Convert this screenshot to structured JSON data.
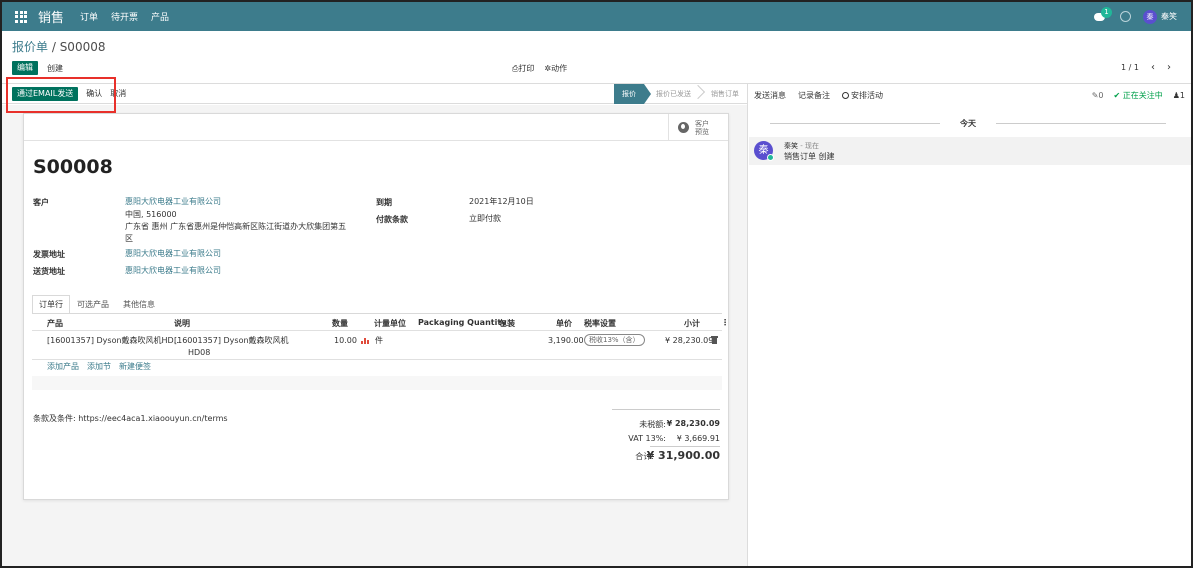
{
  "navbar": {
    "brand": "销售",
    "menu": [
      "订单",
      "待开票",
      "产品"
    ],
    "chat_badge": "1",
    "user_avatar": "秦",
    "user_name": "秦笑"
  },
  "breadcrumb": {
    "parent": "报价单",
    "separator": " / ",
    "current": "S00008"
  },
  "controls": {
    "edit": "编辑",
    "create": "创建",
    "print": "打印",
    "action": "动作",
    "pager": "1 / 1"
  },
  "statusbar": {
    "send_email": "通过EMAIL发送",
    "confirm": "确认",
    "cancel": "取消",
    "stages": [
      "报价",
      "报价已发送",
      "销售订单"
    ]
  },
  "preview": {
    "line1": "客户",
    "line2": "预览"
  },
  "order": {
    "name": "S00008",
    "customer_label": "客户",
    "customer_name": "惠阳大欣电器工业有限公司",
    "customer_addr1": "中国, 516000",
    "customer_addr2": "广东省 惠州 广东省惠州是仲恺高新区陈江街道办大欣集团第五",
    "customer_addr3": "区",
    "invoice_label": "发票地址",
    "invoice_value": "惠阳大欣电器工业有限公司",
    "delivery_label": "送货地址",
    "delivery_value": "惠阳大欣电器工业有限公司",
    "expiry_label": "到期",
    "expiry_value": "2021年12月10日",
    "terms_label": "付款条款",
    "terms_value": "立即付款"
  },
  "tabs": [
    "订单行",
    "可选产品",
    "其他信息"
  ],
  "lines": {
    "headers": {
      "product": "产品",
      "description": "说明",
      "qty": "数量",
      "uom": "计量单位",
      "packaging": "Packaging Quantity",
      "package": "包装",
      "price": "单价",
      "tax": "税率设置",
      "subtotal": "小计",
      "options": "⋮"
    },
    "rows": [
      {
        "product": "[16001357] Dyson戴森吹风机HD...",
        "desc1": "[16001357] Dyson戴森吹风机",
        "desc2": "HD08",
        "qty": "10.00",
        "uom": "件",
        "price": "3,190.00",
        "tax": "税收13%（含）",
        "subtotal": "¥ 28,230.09"
      }
    ],
    "add_product": "添加产品",
    "add_section": "添加节",
    "add_note": "新建便签"
  },
  "footer": {
    "terms": "条款及条件: https://eec4aca1.xiaoouyun.cn/terms",
    "untaxed_label": "未税额:",
    "untaxed_value": "¥ 28,230.09",
    "vat_label": "VAT 13%:",
    "vat_value": "¥ 3,669.91",
    "total_label": "合计:",
    "total_value": "¥ 31,900.00"
  },
  "chatter": {
    "send_message": "发送消息",
    "log_note": "记录备注",
    "schedule": "安排活动",
    "attachments": "0",
    "following": "✔ 正在关注中",
    "followers": "1",
    "today": "今天",
    "author": "秦笑",
    "time": " - 现在",
    "avatar": "秦",
    "body": "销售订单 创建"
  },
  "colors": {
    "navbar": "#3d7c8c",
    "primary": "#00725e",
    "link": "#3d7c8c",
    "highlight": "#e8302a"
  }
}
